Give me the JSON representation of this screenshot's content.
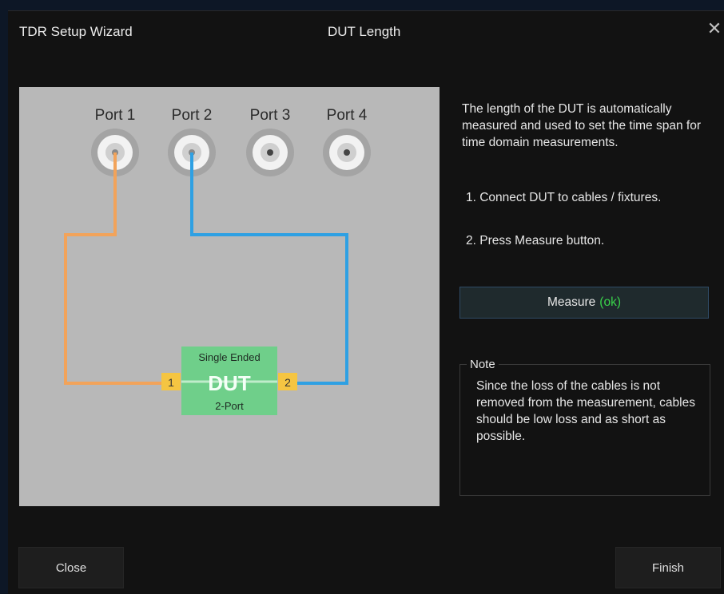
{
  "dialog": {
    "title": "TDR Setup Wizard",
    "page_title": "DUT Length",
    "close_glyph": "✕"
  },
  "diagram": {
    "ports": [
      "Port 1",
      "Port 2",
      "Port 3",
      "Port 4"
    ],
    "dut": {
      "top_label": "Single Ended",
      "name": "DUT",
      "bottom_label": "2-Port",
      "pin1": "1",
      "pin2": "2"
    },
    "colors": {
      "background": "#b8b8b8",
      "cable_port1": "#f2a35a",
      "cable_port2": "#2ea0e3",
      "dut_box": "#6fcf8a",
      "pin": "#f5c542"
    }
  },
  "info": {
    "description": "The length of the DUT is automatically measured and used to set the time span for time domain measurements.",
    "step1": "1. Connect DUT to cables / fixtures.",
    "step2": "2. Press Measure button."
  },
  "measure": {
    "label": "Measure",
    "status": "(ok)"
  },
  "note": {
    "title": "Note",
    "text": "Since the loss of the cables is not removed from the measurement, cables should be low loss and as short as possible."
  },
  "buttons": {
    "close": "Close",
    "finish": "Finish"
  }
}
